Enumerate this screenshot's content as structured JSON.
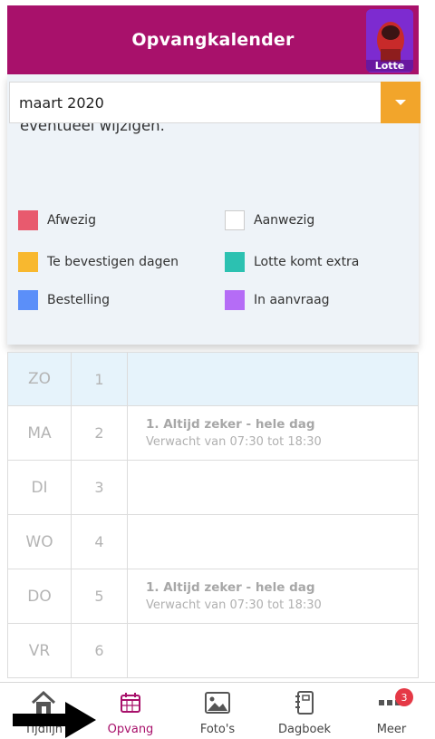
{
  "header": {
    "title": "Opvangkalender",
    "avatar_name": "Lotte"
  },
  "intro": "Hier kunt u de opvang van uw kind inzien en eventueel wijzigen.",
  "month_select": {
    "value": "maart 2020",
    "caret_color": "#f2a52b"
  },
  "legend": [
    {
      "label": "Afwezig",
      "color": "#e85a6e"
    },
    {
      "label": "Aanwezig",
      "color": "#ffffff"
    },
    {
      "label": "Te bevestigen dagen",
      "color": "#f8b82f"
    },
    {
      "label": "Lotte komt extra",
      "color": "#2cc1b1"
    },
    {
      "label": "Bestelling",
      "color": "#5b8ff9"
    },
    {
      "label": "In aanvraag",
      "color": "#b56cf6"
    }
  ],
  "calendar": [
    {
      "day": "ZO",
      "num": "1",
      "title": "",
      "sub": ""
    },
    {
      "day": "MA",
      "num": "2",
      "title": "1. Altijd zeker - hele dag",
      "sub": "Verwacht van 07:30 tot 18:30"
    },
    {
      "day": "DI",
      "num": "3",
      "title": "",
      "sub": ""
    },
    {
      "day": "WO",
      "num": "4",
      "title": "",
      "sub": ""
    },
    {
      "day": "DO",
      "num": "5",
      "title": "1. Altijd zeker - hele dag",
      "sub": "Verwacht van 07:30 tot 18:30"
    },
    {
      "day": "VR",
      "num": "6",
      "title": "",
      "sub": ""
    }
  ],
  "nav": {
    "items": [
      {
        "label": "Tijdlijn",
        "icon": "home-icon"
      },
      {
        "label": "Opvang",
        "icon": "calendar-icon",
        "active": true
      },
      {
        "label": "Foto's",
        "icon": "image-icon"
      },
      {
        "label": "Dagboek",
        "icon": "notebook-icon"
      },
      {
        "label": "Meer",
        "icon": "more-icon",
        "badge": "3"
      }
    ]
  },
  "colors": {
    "brand": "#a8116b",
    "accent": "#f2a52b",
    "badge": "#e53946"
  }
}
